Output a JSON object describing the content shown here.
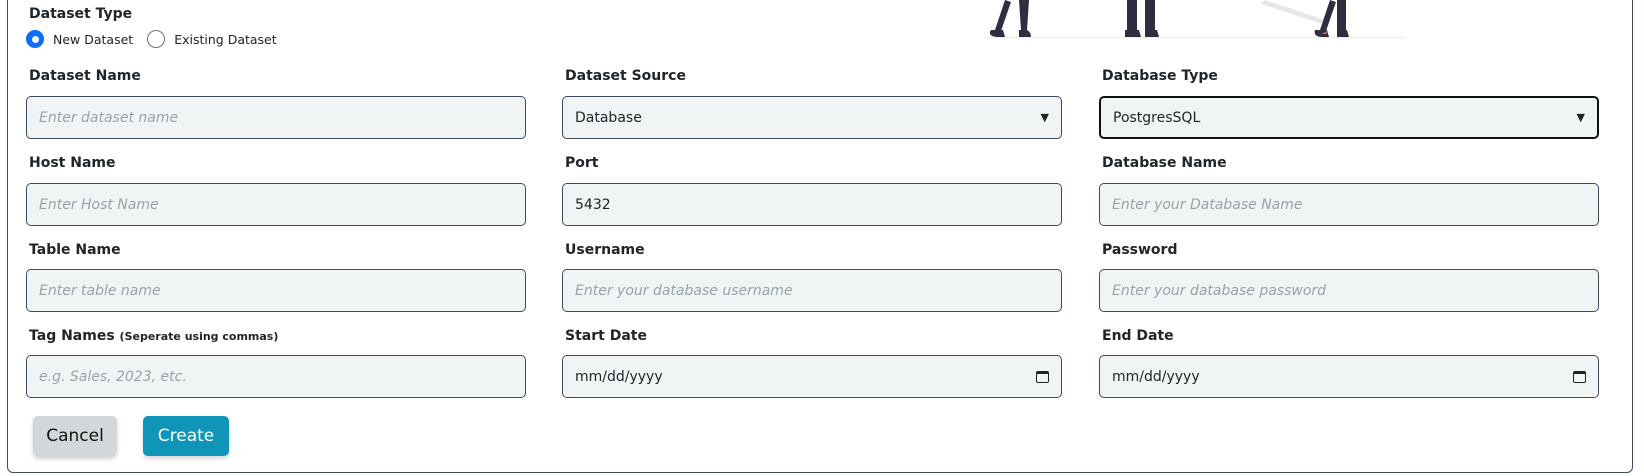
{
  "dataset_type": {
    "label": "Dataset Type",
    "options": [
      {
        "label": "New Dataset",
        "checked": true
      },
      {
        "label": "Existing Dataset",
        "checked": false
      }
    ]
  },
  "fields": {
    "dataset_name": {
      "label": "Dataset Name",
      "placeholder": "Enter dataset name",
      "value": ""
    },
    "dataset_source": {
      "label": "Dataset Source",
      "value": "Database"
    },
    "database_type": {
      "label": "Database Type",
      "value": "PostgresSQL"
    },
    "host_name": {
      "label": "Host Name",
      "placeholder": "Enter Host Name",
      "value": ""
    },
    "port": {
      "label": "Port",
      "value": "5432"
    },
    "database_name": {
      "label": "Database Name",
      "placeholder": "Enter your Database Name",
      "value": ""
    },
    "table_name": {
      "label": "Table Name",
      "placeholder": "Enter table name",
      "value": ""
    },
    "username": {
      "label": "Username",
      "placeholder": "Enter your database username",
      "value": ""
    },
    "password": {
      "label": "Password",
      "placeholder": "Enter your database password",
      "value": ""
    },
    "tag_names": {
      "label": "Tag Names",
      "hint": "(Seperate using commas)",
      "placeholder": "e.g. Sales, 2023, etc.",
      "value": ""
    },
    "start_date": {
      "label": "Start Date",
      "value": "mm/dd/yyyy"
    },
    "end_date": {
      "label": "End Date",
      "value": "mm/dd/yyyy"
    }
  },
  "buttons": {
    "cancel": "Cancel",
    "create": "Create"
  },
  "icons": {
    "select_chevron": "chevron-down-icon",
    "date_picker": "calendar-icon"
  },
  "colors": {
    "primary_radio": "#0d6efd",
    "create_button": "#0f95b8",
    "cancel_button": "#d3d6da",
    "input_background": "#f1f4f5",
    "border": "#3b4a5e"
  }
}
